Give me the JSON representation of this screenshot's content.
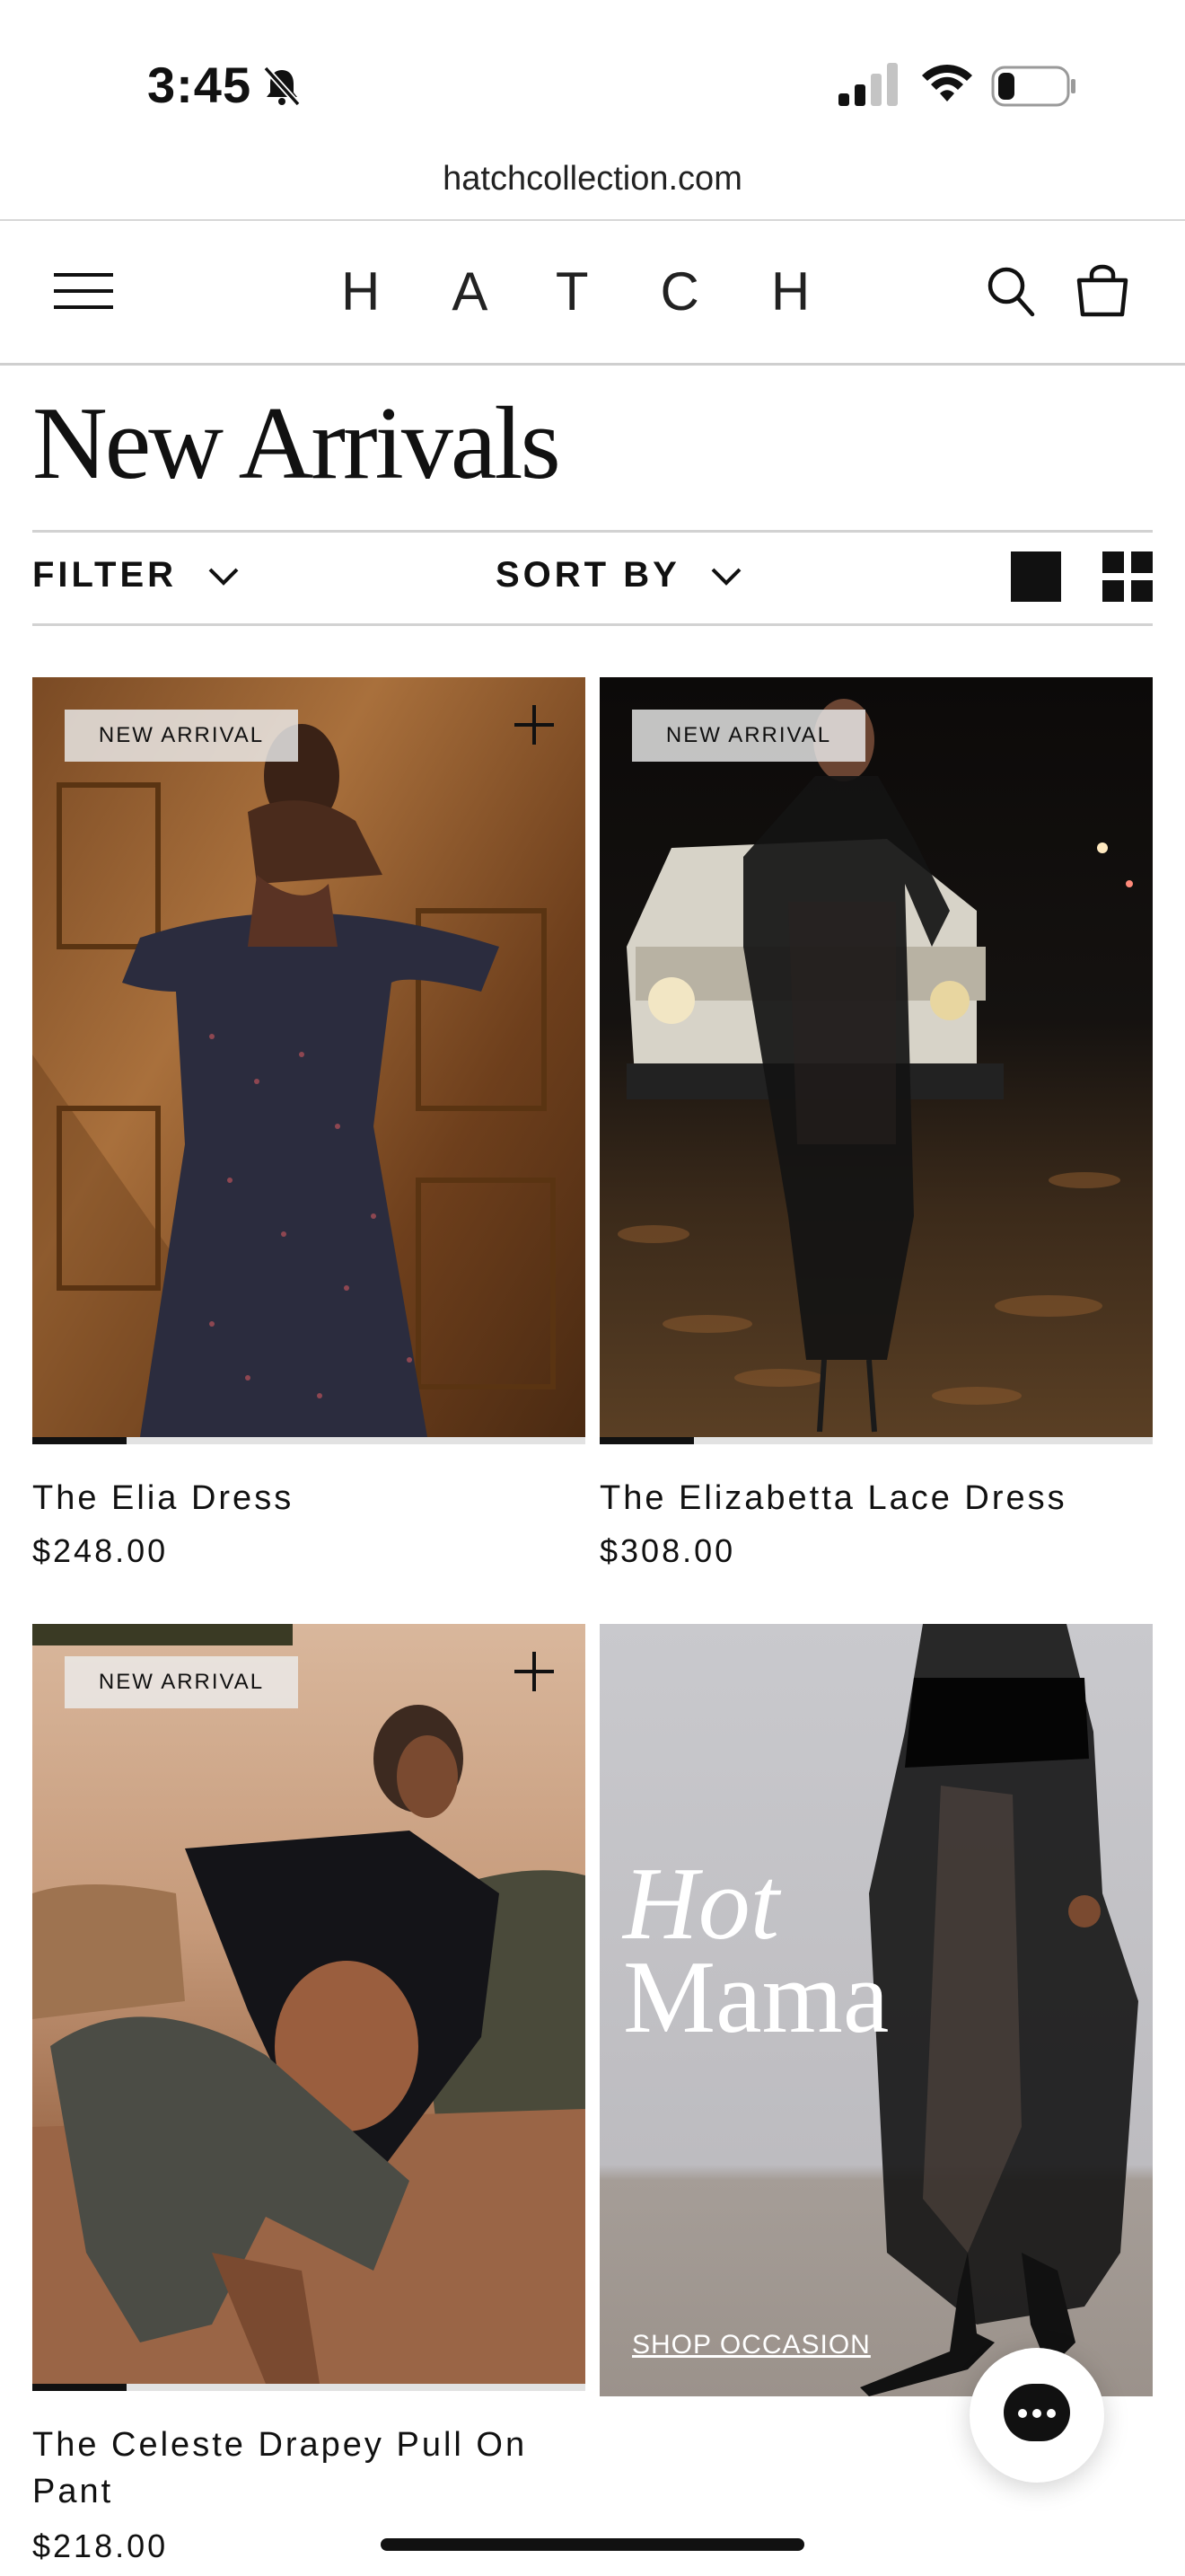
{
  "status": {
    "time": "3:45"
  },
  "browser": {
    "url": "hatchcollection.com"
  },
  "header": {
    "logo": "HATCH"
  },
  "page": {
    "title": "New Arrivals"
  },
  "controls": {
    "filter_label": "FILTER",
    "sort_label": "SORT BY"
  },
  "products": [
    {
      "badge": "NEW ARRIVAL",
      "name": "The Elia Dress",
      "price": "$248.00",
      "progress": 0.17
    },
    {
      "badge": "NEW ARRIVAL",
      "name": "The Elizabetta Lace Dress",
      "price": "$308.00",
      "progress": 0.17
    },
    {
      "badge": "NEW ARRIVAL",
      "name": "The Celeste Drapey Pull On Pant",
      "price": "$218.00",
      "progress": 0.17
    }
  ],
  "promo": {
    "line1": "Hot",
    "line2": "Mama",
    "link_label": "SHOP OCCASION"
  },
  "colors": {
    "text": "#111111",
    "rule": "#d2d2d2",
    "badge_bg": "#ebebeb",
    "promo_bg": "#c4c4c8"
  }
}
